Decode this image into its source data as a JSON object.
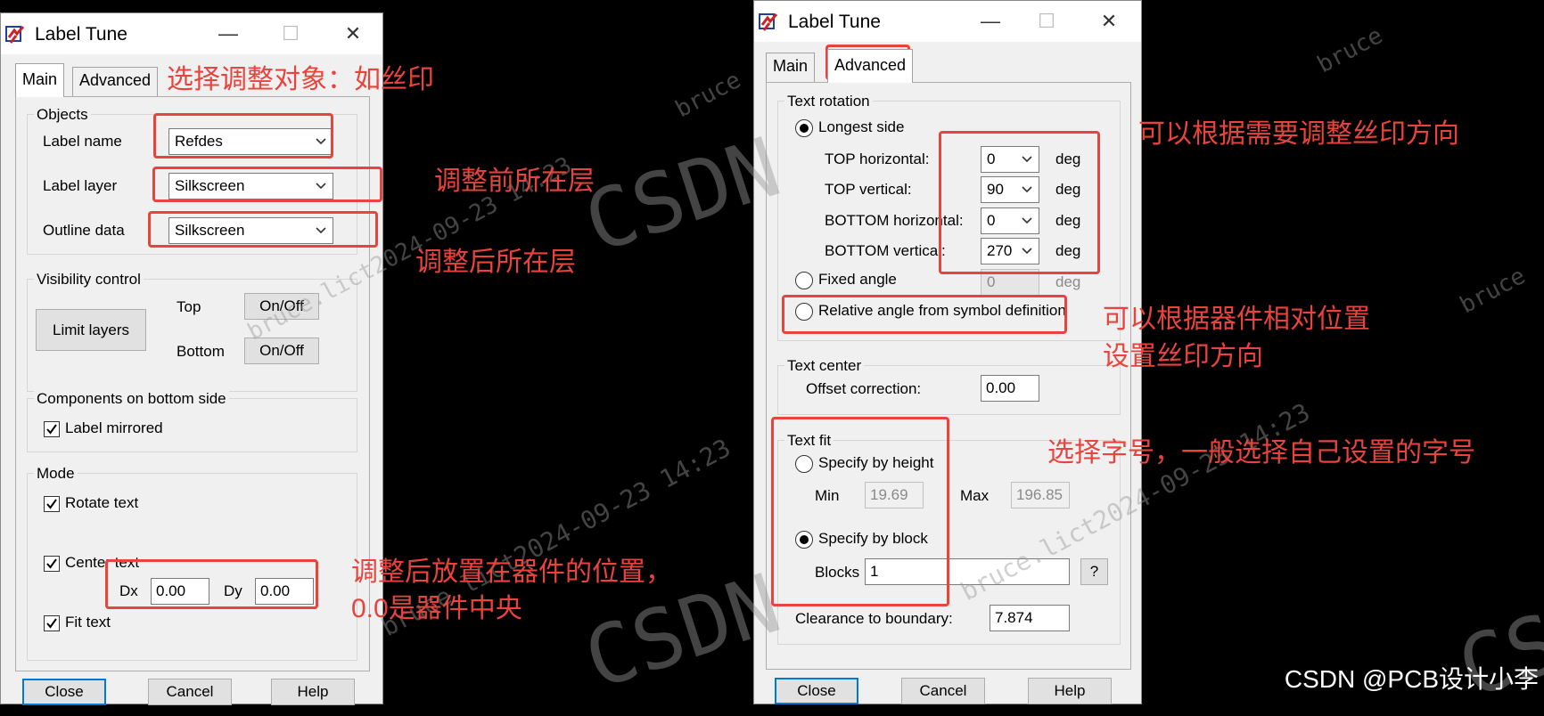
{
  "window_title": "Label Tune",
  "tabs": {
    "main": "Main",
    "advanced": "Advanced"
  },
  "main_panel": {
    "objects": {
      "group": "Objects",
      "label_name": {
        "label": "Label name",
        "value": "Refdes"
      },
      "label_layer": {
        "label": "Label layer",
        "value": "Silkscreen"
      },
      "outline_data": {
        "label": "Outline data",
        "value": "Silkscreen"
      }
    },
    "visibility": {
      "group": "Visibility control",
      "limit_layers": "Limit layers",
      "top_label": "Top",
      "bottom_label": "Bottom",
      "onoff": "On/Off"
    },
    "components_bottom": {
      "group": "Components on bottom side",
      "label_mirrored": "Label mirrored"
    },
    "mode": {
      "group": "Mode",
      "rotate_text": "Rotate text",
      "center_text": "Center text",
      "dx_label": "Dx",
      "dx_value": "0.00",
      "dy_label": "Dy",
      "dy_value": "0.00",
      "fit_text": "Fit text"
    }
  },
  "advanced_panel": {
    "text_rotation": {
      "group": "Text rotation",
      "longest_side": "Longest side",
      "top_horizontal": {
        "label": "TOP horizontal:",
        "value": "0"
      },
      "top_vertical": {
        "label": "TOP vertical:",
        "value": "90"
      },
      "bottom_horizontal": {
        "label": "BOTTOM horizontal:",
        "value": "0"
      },
      "bottom_vertical": {
        "label": "BOTTOM vertical:",
        "value": "270"
      },
      "deg": "deg",
      "fixed_angle": "Fixed angle",
      "fixed_value": "0",
      "relative_angle": "Relative angle from symbol definition"
    },
    "text_center": {
      "group": "Text center",
      "offset_label": "Offset correction:",
      "offset_value": "0.00"
    },
    "text_fit": {
      "group": "Text fit",
      "specify_height": "Specify by height",
      "min_label": "Min",
      "min_value": "19.69",
      "max_label": "Max",
      "max_value": "196.85",
      "specify_block": "Specify by block",
      "blocks_label": "Blocks",
      "blocks_value": "1",
      "help_q": "?",
      "clearance_label": "Clearance to boundary:",
      "clearance_value": "7.874"
    }
  },
  "buttons": {
    "close": "Close",
    "cancel": "Cancel",
    "help": "Help"
  },
  "annotations": {
    "choose_object": "选择调整对象：如丝印",
    "layer_before": "调整前所在层",
    "layer_after": "调整后所在层",
    "position_1": "调整后放置在器件的位置，",
    "position_2": "0.0是器件中央",
    "direction": "可以根据需要调整丝印方向",
    "relative_1": "可以根据器件相对位置",
    "relative_2": "设置丝印方向",
    "font_size": "选择字号，一般选择自己设置的字号"
  },
  "watermarks": {
    "csdn": "CSDN",
    "stamp": "bruce.lict2024-09-23 14:23",
    "bruce": "bruce"
  },
  "signature": "CSDN @PCB设计小李",
  "colors": {
    "annotation": "#e8433d",
    "dialog_bg": "#f0f0f0",
    "default_button": "#0078d7"
  }
}
